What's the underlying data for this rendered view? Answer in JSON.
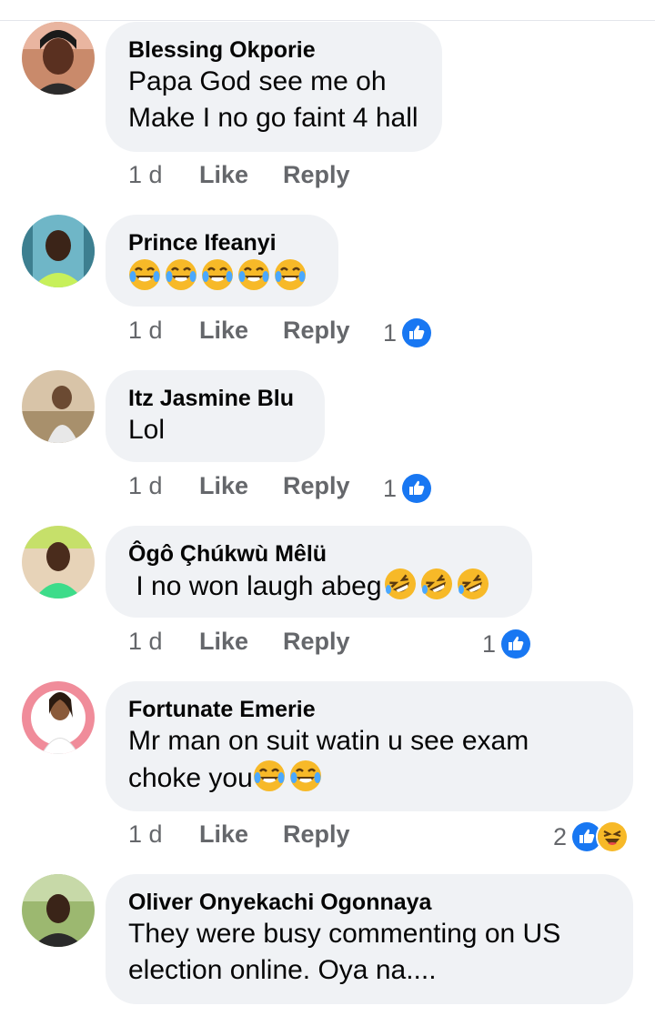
{
  "colors": {
    "bubble": "#f0f2f5",
    "meta": "#65676b",
    "like_blue": "#1877f2",
    "haha_yellow": "#f7b928"
  },
  "comments": [
    {
      "name": "Blessing Okporie",
      "lines": [
        "Papa God see me oh",
        "Make I no go faint 4 hall"
      ],
      "time": "1 d",
      "like": "Like",
      "reply": "Reply",
      "reaction_count": ""
    },
    {
      "name": "Prince Ifeanyi",
      "lines": [
        ""
      ],
      "emoji": "tears-of-joy x5",
      "time": "1 d",
      "like": "Like",
      "reply": "Reply",
      "reaction_count": "1"
    },
    {
      "name": "Itz Jasmine Blu",
      "lines": [
        "Lol"
      ],
      "time": "1 d",
      "like": "Like",
      "reply": "Reply",
      "reaction_count": "1"
    },
    {
      "name": "Ôgô Çhúkwù Mêlü",
      "lines": [
        " I no won laugh abeg"
      ],
      "emoji": "rolling-laughing x3",
      "time": "1 d",
      "like": "Like",
      "reply": "Reply",
      "reaction_count": "1"
    },
    {
      "name": "Fortunate Emerie",
      "lines": [
        "Mr man on suit watin u see exam",
        "choke you"
      ],
      "emoji": "tears-of-joy x2",
      "time": "1 d",
      "like": "Like",
      "reply": "Reply",
      "reaction_count": "2"
    },
    {
      "name": "Oliver Onyekachi Ogonnaya",
      "lines": [
        "They were busy commenting on US",
        "election online. Oya na...."
      ]
    }
  ]
}
